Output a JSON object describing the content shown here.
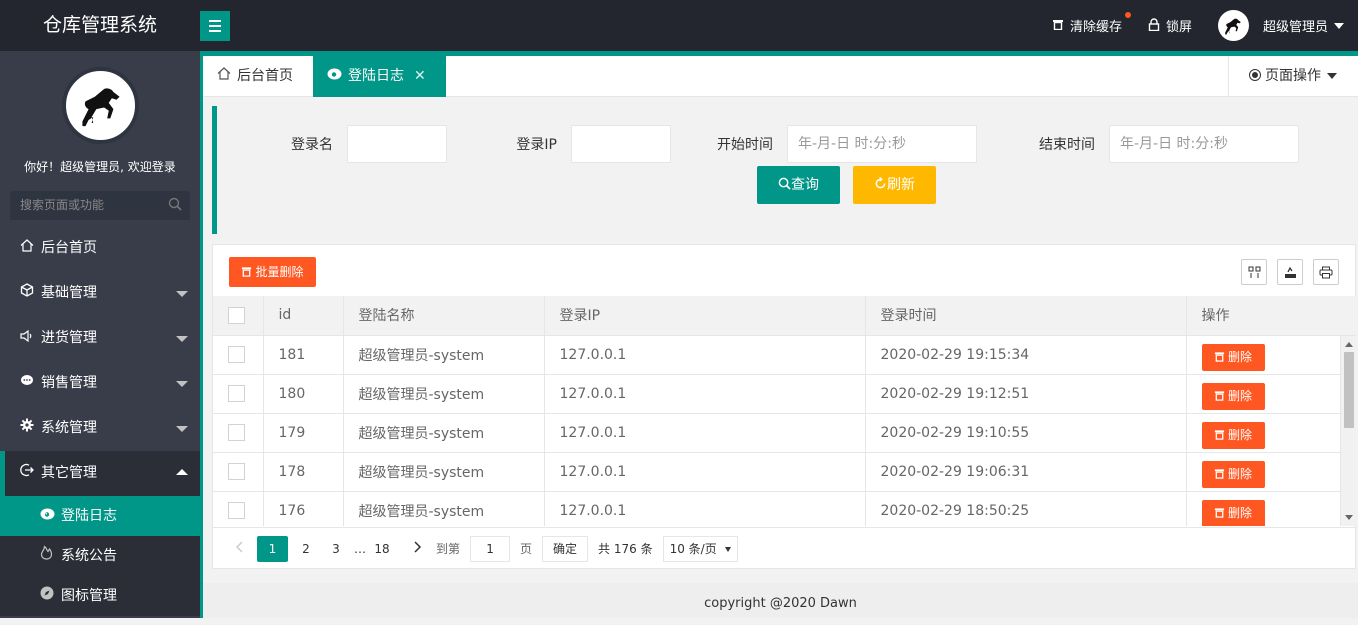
{
  "header": {
    "app_title": "仓库管理系统",
    "clear_cache": "清除缓存",
    "lock_screen": "锁屏",
    "user_name": "超级管理员"
  },
  "sidebar": {
    "welcome": "你好！超级管理员, 欢迎登录",
    "search_placeholder": "搜索页面或功能",
    "items": [
      {
        "label": "后台首页",
        "icon": "home-icon"
      },
      {
        "label": "基础管理",
        "icon": "cube-icon"
      },
      {
        "label": "进货管理",
        "icon": "speaker-icon"
      },
      {
        "label": "销售管理",
        "icon": "chat-icon"
      },
      {
        "label": "系统管理",
        "icon": "gear-icon"
      },
      {
        "label": "其它管理",
        "icon": "logout-icon"
      }
    ],
    "sub_items": [
      {
        "label": "登陆日志",
        "icon": "eye-icon"
      },
      {
        "label": "系统公告",
        "icon": "fire-icon"
      },
      {
        "label": "图标管理",
        "icon": "compass-icon"
      }
    ]
  },
  "tabs": {
    "home": "后台首页",
    "active": "登陆日志",
    "page_ops": "页面操作"
  },
  "search": {
    "login_name_label": "登录名",
    "login_ip_label": "登录IP",
    "start_time_label": "开始时间",
    "end_time_label": "结束时间",
    "start_time_placeholder": "年-月-日 时:分:秒",
    "end_time_placeholder": "年-月-日 时:分:秒",
    "query_button": "查询",
    "refresh_button": "刷新"
  },
  "table": {
    "batch_delete": "批量删除",
    "columns": [
      "id",
      "登陆名称",
      "登录IP",
      "登录时间",
      "操作"
    ],
    "delete_label": "删除",
    "rows": [
      {
        "id": "181",
        "name": "超级管理员-system",
        "ip": "127.0.0.1",
        "time": "2020-02-29 19:15:34"
      },
      {
        "id": "180",
        "name": "超级管理员-system",
        "ip": "127.0.0.1",
        "time": "2020-02-29 19:12:51"
      },
      {
        "id": "179",
        "name": "超级管理员-system",
        "ip": "127.0.0.1",
        "time": "2020-02-29 19:10:55"
      },
      {
        "id": "178",
        "name": "超级管理员-system",
        "ip": "127.0.0.1",
        "time": "2020-02-29 19:06:31"
      },
      {
        "id": "176",
        "name": "超级管理员-system",
        "ip": "127.0.0.1",
        "time": "2020-02-29 18:50:25"
      }
    ]
  },
  "pager": {
    "pages": [
      "1",
      "2",
      "3",
      "…",
      "18"
    ],
    "goto_label": "到第",
    "goto_value": "1",
    "page_unit": "页",
    "confirm": "确定",
    "total": "共 176 条",
    "page_size": "10 条/页"
  },
  "footer": {
    "copyright": "copyright @2020 Dawn"
  }
}
